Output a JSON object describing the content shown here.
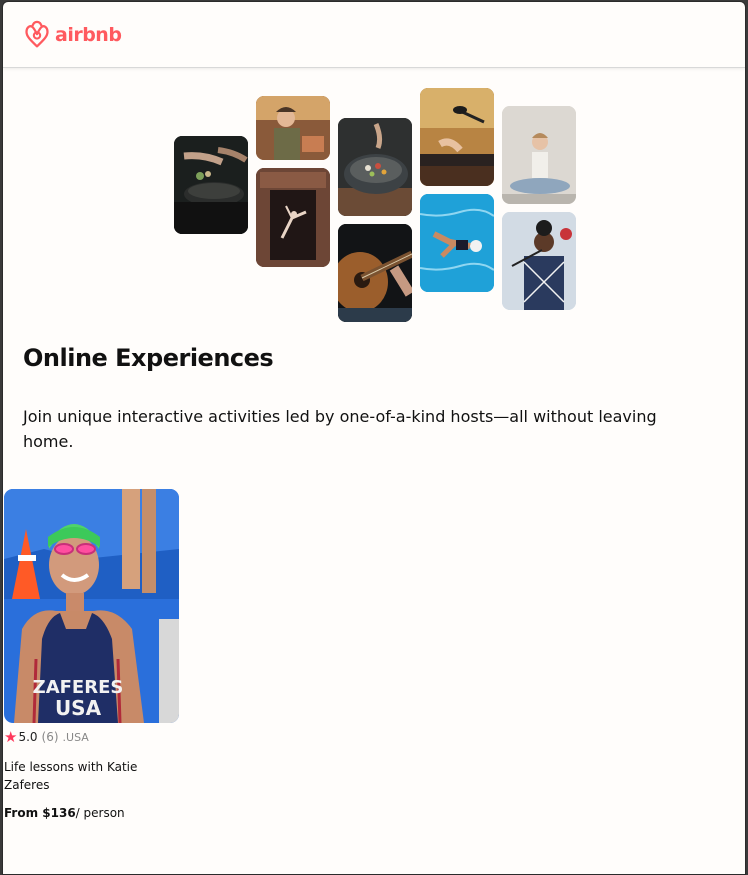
{
  "brand": {
    "name": "airbnb",
    "logo_icon": "airbnb-belo-icon",
    "color": "#ff5a5f"
  },
  "hero": {
    "photos": [
      {
        "name": "hero-photo-cooking-pan",
        "desc_icon": "cooking-photo"
      },
      {
        "name": "hero-photo-woman-chef",
        "desc_icon": "chef-photo"
      },
      {
        "name": "hero-photo-dancer-doorway",
        "desc_icon": "dancer-photo"
      },
      {
        "name": "hero-photo-food-bowl",
        "desc_icon": "food-photo"
      },
      {
        "name": "hero-photo-guitar",
        "desc_icon": "guitar-photo"
      },
      {
        "name": "hero-photo-microphone-piano",
        "desc_icon": "music-photo"
      },
      {
        "name": "hero-photo-swimmer",
        "desc_icon": "swimmer-photo"
      },
      {
        "name": "hero-photo-yoga",
        "desc_icon": "yoga-photo"
      },
      {
        "name": "hero-photo-singer",
        "desc_icon": "singer-photo"
      }
    ]
  },
  "main": {
    "title": "Online Experiences",
    "subtitle": "Join unique interactive activities led by one-of-a-kind hosts—all without leaving home."
  },
  "card": {
    "rating": "5.0",
    "review_count": "(6)",
    "country": ".USA",
    "title": "Life lessons with Katie Zaferes",
    "price_prefix": "From $136",
    "price_suffix": "/ person",
    "jersey_line1": "ZAFERES",
    "jersey_line2": "USA",
    "star_color": "#ff385c"
  }
}
